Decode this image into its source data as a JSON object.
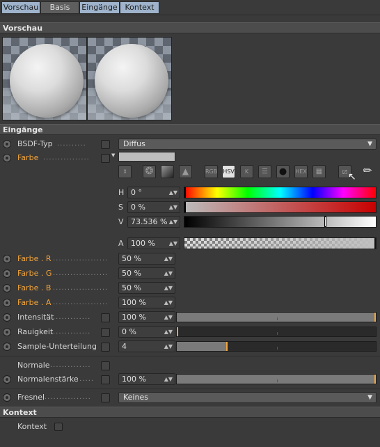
{
  "tabs": [
    {
      "label": "Vorschau"
    },
    {
      "label": "Basis"
    },
    {
      "label": "Eingänge"
    },
    {
      "label": "Kontext"
    }
  ],
  "sections": {
    "preview": "Vorschau",
    "inputs": "Eingänge",
    "context": "Kontext"
  },
  "bsdf": {
    "label": "BSDF-Typ",
    "value": "Diffus"
  },
  "farbe": {
    "label": "Farbe",
    "swatch": "#bebebe"
  },
  "color_modes": [
    "RGB",
    "HSV",
    "K",
    "HEX"
  ],
  "hsv": {
    "h_label": "H",
    "h_value": "0 °",
    "s_label": "S",
    "s_value": "0 %",
    "v_label": "V",
    "v_value": "73.536 %",
    "v_fraction": 0.735
  },
  "alpha": {
    "label": "A",
    "value": "100 %"
  },
  "channels": [
    {
      "label": "Farbe . R",
      "value": "50 %"
    },
    {
      "label": "Farbe . G",
      "value": "50 %"
    },
    {
      "label": "Farbe . B",
      "value": "50 %"
    },
    {
      "label": "Farbe . A",
      "value": "100 %"
    }
  ],
  "params": [
    {
      "label": "Intensität",
      "value": "100 %",
      "fraction": 1.0
    },
    {
      "label": "Rauigkeit",
      "value": "0 %",
      "fraction": 0.0
    },
    {
      "label": "Sample-Unterteilung",
      "value": "4",
      "fraction": 0.25
    }
  ],
  "normale": {
    "label": "Normale"
  },
  "normalenstaerke": {
    "label": "Normalenstärke",
    "value": "100 %",
    "fraction": 1.0
  },
  "fresnel": {
    "label": "Fresnel",
    "value": "Keines"
  },
  "kontext": {
    "label": "Kontext"
  },
  "colors": {
    "accent": "#f2a43a",
    "tab_active": "#9fb4cc"
  }
}
